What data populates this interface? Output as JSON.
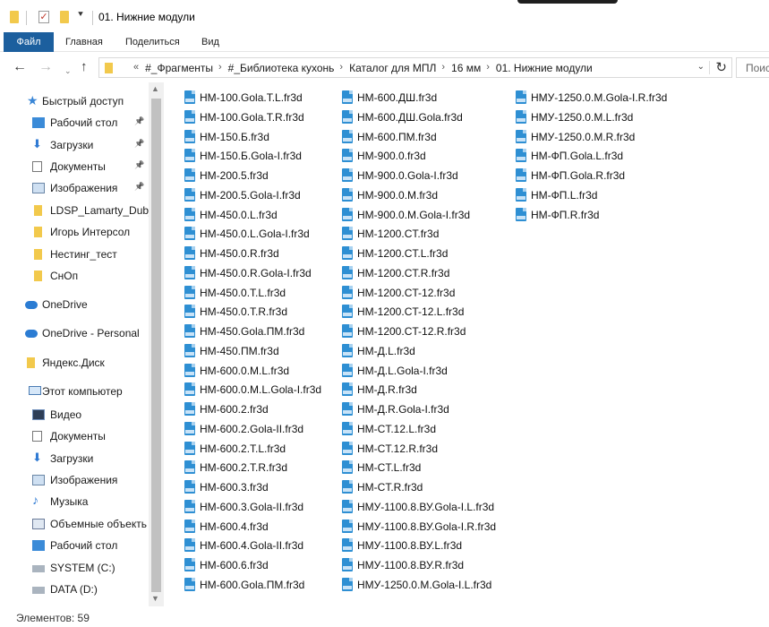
{
  "window": {
    "title": "01. Нижние модули",
    "dropdown_glyph": "⯆"
  },
  "ribbon": {
    "tabs": [
      "Файл",
      "Главная",
      "Поделиться",
      "Вид"
    ]
  },
  "address": {
    "prefix": "«",
    "crumbs": [
      "#_Фрагменты",
      "#_Библиотека кухонь",
      "Каталог для МПЛ",
      "16 мм",
      "01. Нижние модули"
    ],
    "separator": "›",
    "search_placeholder": "Поис"
  },
  "nav_pane": {
    "items": [
      {
        "label": "Быстрый доступ",
        "icon": "star-icon",
        "pinned": false
      },
      {
        "label": "Рабочий стол",
        "icon": "desktop-icon",
        "pinned": true
      },
      {
        "label": "Загрузки",
        "icon": "download-icon",
        "pinned": true
      },
      {
        "label": "Документы",
        "icon": "documents-icon",
        "pinned": true
      },
      {
        "label": "Изображения",
        "icon": "pictures-icon",
        "pinned": true
      },
      {
        "label": "LDSP_Lamarty_Dub_",
        "icon": "folder-icon",
        "pinned": false
      },
      {
        "label": "Игорь Интерсол",
        "icon": "folder-icon",
        "pinned": false
      },
      {
        "label": "Нестинг_тест",
        "icon": "folder-icon",
        "pinned": false
      },
      {
        "label": "СнОп",
        "icon": "folder-icon",
        "pinned": false
      },
      {
        "label": "OneDrive",
        "icon": "onedrive-icon",
        "pinned": false
      },
      {
        "label": "OneDrive - Personal",
        "icon": "onedrive-icon",
        "pinned": false
      },
      {
        "label": "Яндекс.Диск",
        "icon": "yandex-disk-icon",
        "pinned": false
      },
      {
        "label": "Этот компьютер",
        "icon": "computer-icon",
        "pinned": false
      },
      {
        "label": "Видео",
        "icon": "video-icon",
        "pinned": false
      },
      {
        "label": "Документы",
        "icon": "documents-icon",
        "pinned": false
      },
      {
        "label": "Загрузки",
        "icon": "download-icon",
        "pinned": false
      },
      {
        "label": "Изображения",
        "icon": "pictures-icon",
        "pinned": false
      },
      {
        "label": "Музыка",
        "icon": "music-icon",
        "pinned": false
      },
      {
        "label": "Объемные объекть",
        "icon": "3d-objects-icon",
        "pinned": false
      },
      {
        "label": "Рабочий стол",
        "icon": "desktop-icon",
        "pinned": false
      },
      {
        "label": "SYSTEM (C:)",
        "icon": "drive-icon",
        "pinned": false
      },
      {
        "label": "DATA (D:)",
        "icon": "drive-icon",
        "pinned": false
      }
    ]
  },
  "files": {
    "columns": [
      [
        "НМ-100.Gola.T.L.fr3d",
        "НМ-100.Gola.T.R.fr3d",
        "НМ-150.Б.fr3d",
        "НМ-150.Б.Gola-I.fr3d",
        "НМ-200.5.fr3d",
        "НМ-200.5.Gola-I.fr3d",
        "НМ-450.0.L.fr3d",
        "НМ-450.0.L.Gola-I.fr3d",
        "НМ-450.0.R.fr3d",
        "НМ-450.0.R.Gola-I.fr3d",
        "НМ-450.0.T.L.fr3d",
        "НМ-450.0.T.R.fr3d",
        "НМ-450.Gola.ПМ.fr3d",
        "НМ-450.ПМ.fr3d",
        "НМ-600.0.M.L.fr3d",
        "НМ-600.0.M.L.Gola-I.fr3d",
        "НМ-600.2.fr3d",
        "НМ-600.2.Gola-II.fr3d",
        "НМ-600.2.T.L.fr3d",
        "НМ-600.2.T.R.fr3d",
        "НМ-600.3.fr3d",
        "НМ-600.3.Gola-II.fr3d",
        "НМ-600.4.fr3d",
        "НМ-600.4.Gola-II.fr3d",
        "НМ-600.6.fr3d",
        "НМ-600.Gola.ПМ.fr3d"
      ],
      [
        "НМ-600.ДШ.fr3d",
        "НМ-600.ДШ.Gola.fr3d",
        "НМ-600.ПМ.fr3d",
        "НМ-900.0.fr3d",
        "НМ-900.0.Gola-I.fr3d",
        "НМ-900.0.M.fr3d",
        "НМ-900.0.M.Gola-I.fr3d",
        "НМ-1200.CT.fr3d",
        "НМ-1200.CT.L.fr3d",
        "НМ-1200.CT.R.fr3d",
        "НМ-1200.CT-12.fr3d",
        "НМ-1200.CT-12.L.fr3d",
        "НМ-1200.CT-12.R.fr3d",
        "НМ-Д.L.fr3d",
        "НМ-Д.L.Gola-I.fr3d",
        "НМ-Д.R.fr3d",
        "НМ-Д.R.Gola-I.fr3d",
        "НМ-CT.12.L.fr3d",
        "НМ-CT.12.R.fr3d",
        "НМ-CT.L.fr3d",
        "НМ-CT.R.fr3d",
        "НМУ-1100.8.ВУ.Gola-I.L.fr3d",
        "НМУ-1100.8.ВУ.Gola-I.R.fr3d",
        "НМУ-1100.8.ВУ.L.fr3d",
        "НМУ-1100.8.ВУ.R.fr3d",
        "НМУ-1250.0.M.Gola-I.L.fr3d"
      ],
      [
        "НМУ-1250.0.M.Gola-I.R.fr3d",
        "НМУ-1250.0.M.L.fr3d",
        "НМУ-1250.0.M.R.fr3d",
        "НМ-ФП.Gola.L.fr3d",
        "НМ-ФП.Gola.R.fr3d",
        "НМ-ФП.L.fr3d",
        "НМ-ФП.R.fr3d"
      ]
    ]
  },
  "status_bar": {
    "count_text": "Элементов: 59"
  }
}
